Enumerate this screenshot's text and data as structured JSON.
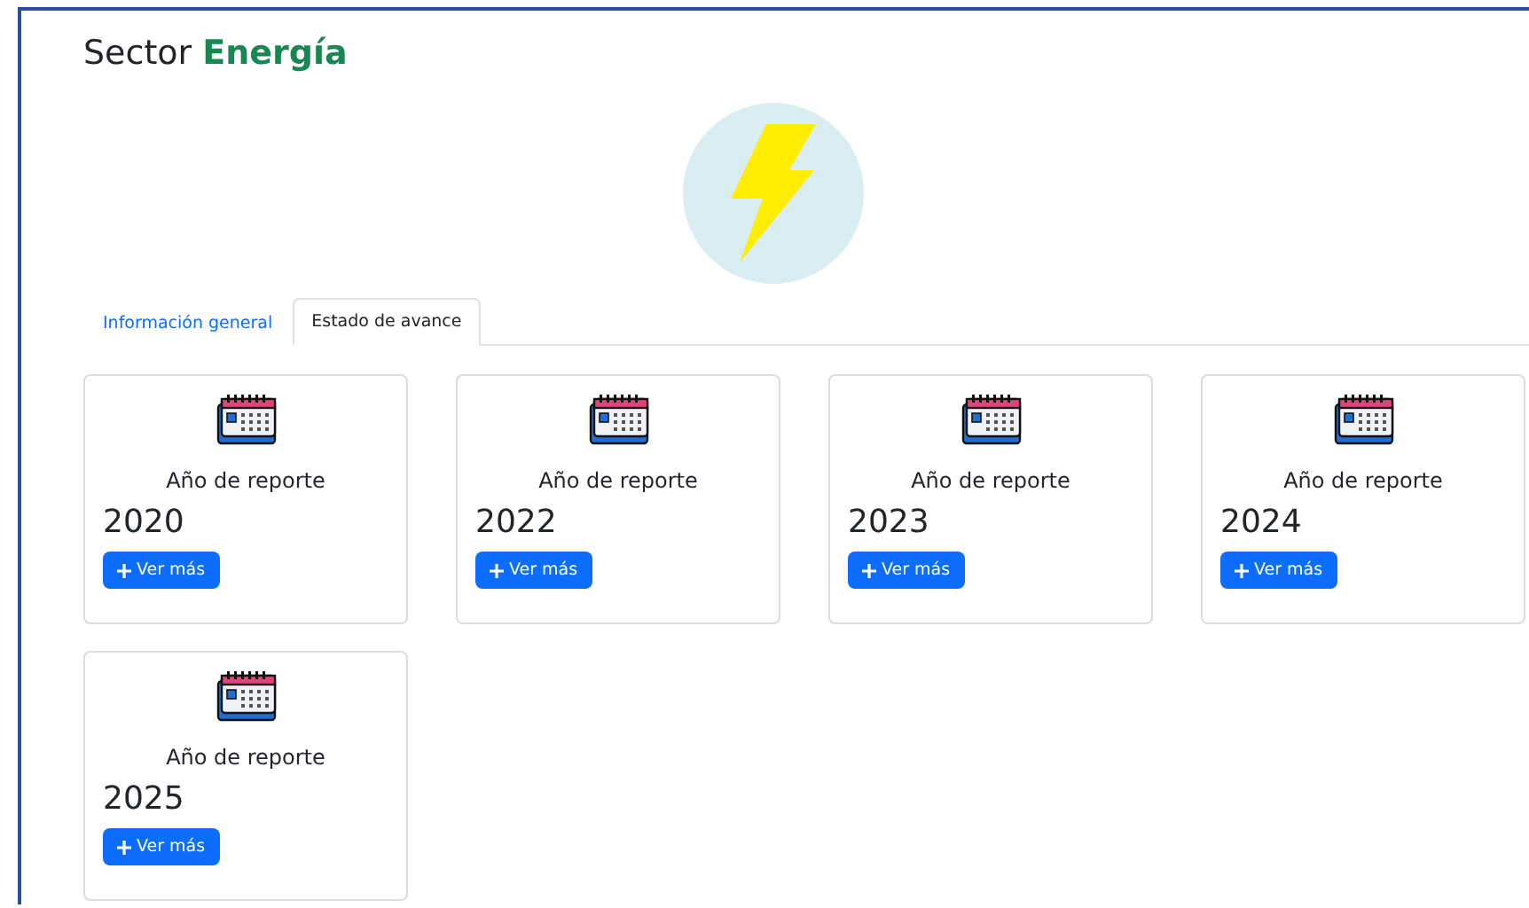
{
  "title": {
    "prefix": "Sector",
    "highlight": "Energía"
  },
  "tabs": [
    {
      "label": "Información general",
      "selected": false
    },
    {
      "label": "Estado de avance",
      "selected": true
    }
  ],
  "cards": [
    {
      "label": "Año de reporte",
      "year": "2020",
      "button": "Ver más"
    },
    {
      "label": "Año de reporte",
      "year": "2022",
      "button": "Ver más"
    },
    {
      "label": "Año de reporte",
      "year": "2023",
      "button": "Ver más"
    },
    {
      "label": "Año de reporte",
      "year": "2024",
      "button": "Ver más"
    },
    {
      "label": "Año de reporte",
      "year": "2025",
      "button": "Ver más"
    }
  ]
}
